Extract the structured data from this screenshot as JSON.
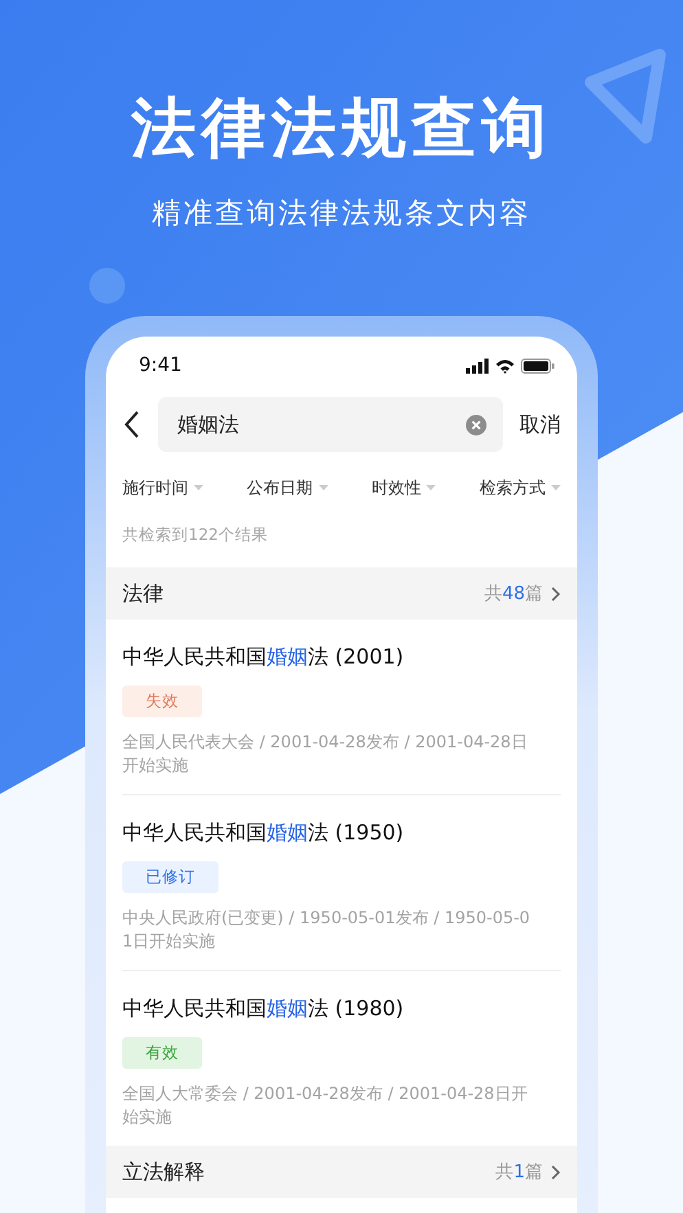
{
  "headline": "法律法规查询",
  "subheadline": "精准查询法律法规条文内容",
  "status_bar": {
    "time": "9:41"
  },
  "search": {
    "value": "婚姻法",
    "cancel": "取消"
  },
  "filters": [
    {
      "label": "施行时间"
    },
    {
      "label": "公布日期"
    },
    {
      "label": "时效性"
    },
    {
      "label": "检索方式"
    }
  ],
  "result_count": "共检索到122个结果",
  "sections": [
    {
      "title": "法律",
      "count_prefix": "共",
      "count": "48",
      "count_suffix": "篇",
      "items": [
        {
          "title_before": "中华人民共和国",
          "highlight": "婚姻",
          "title_after": "法 (2001)",
          "status": "失效",
          "kind": "expired",
          "meta": "全国人民代表大会 / 2001-04-28发布 / 2001-04-28日开始实施"
        },
        {
          "title_before": "中华人民共和国",
          "highlight": "婚姻",
          "title_after": "法 (1950)",
          "status": "已修订",
          "kind": "amended",
          "meta": "中央人民政府(已变更) / 1950-05-01发布 / 1950-05-01日开始实施"
        },
        {
          "title_before": "中华人民共和国",
          "highlight": "婚姻",
          "title_after": "法 (1980)",
          "status": "有效",
          "kind": "valid",
          "meta": "全国人大常委会 / 2001-04-28发布 / 2001-04-28日开始实施"
        }
      ]
    },
    {
      "title": "立法解释",
      "count_prefix": "共",
      "count": "1",
      "count_suffix": "篇"
    }
  ]
}
